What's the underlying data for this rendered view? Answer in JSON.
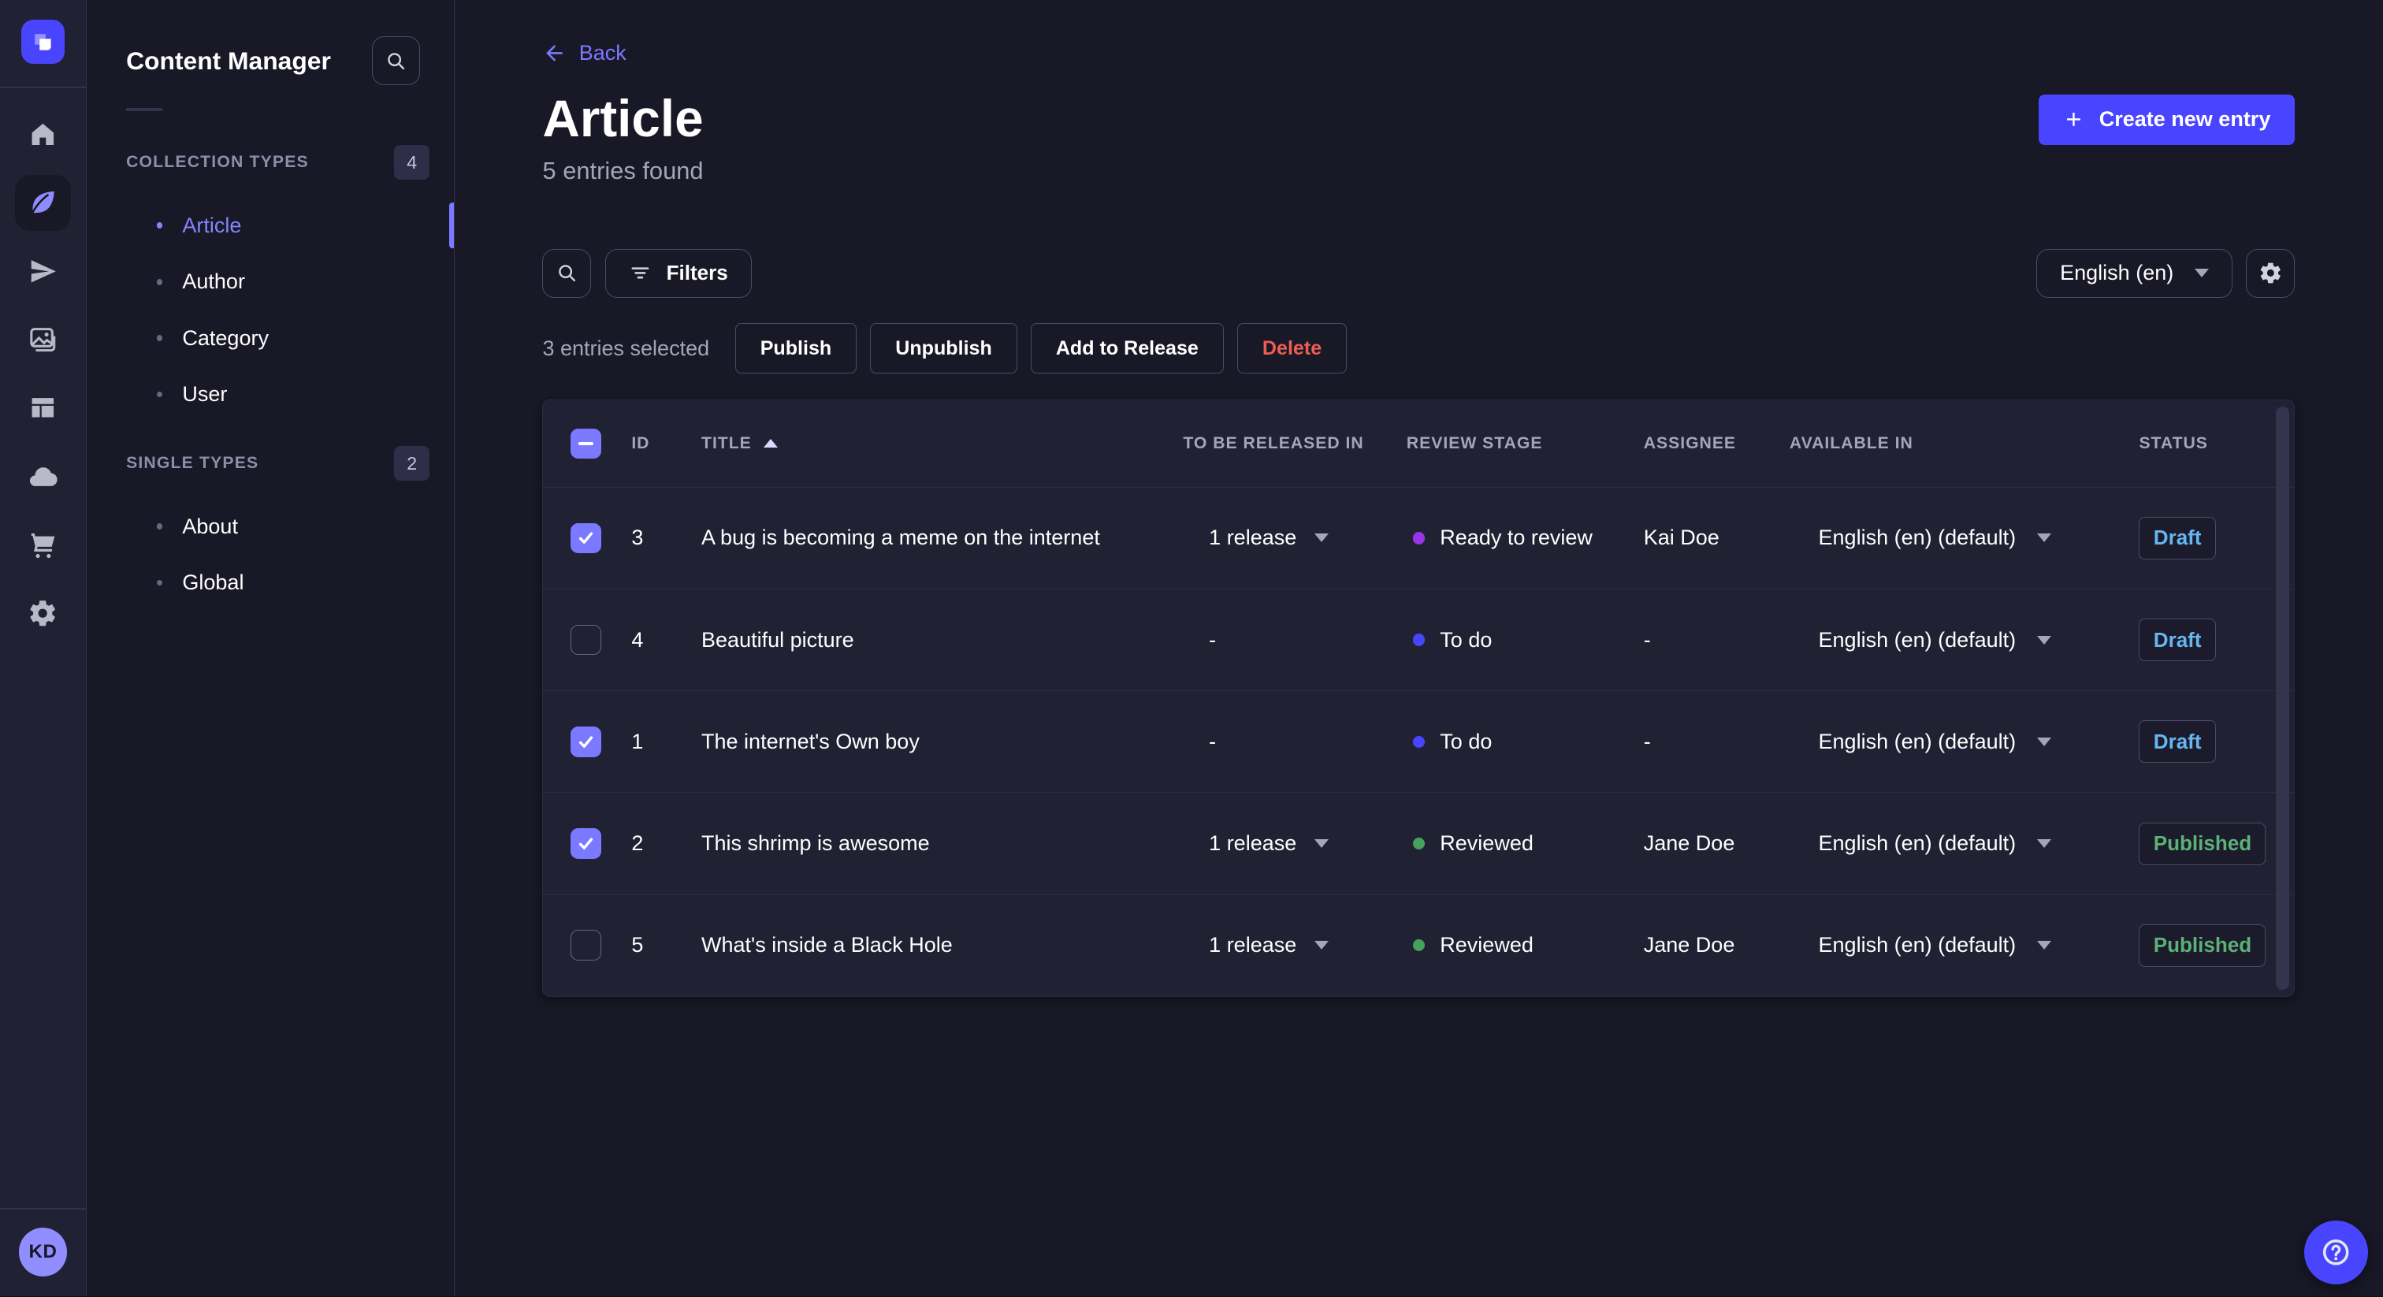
{
  "nav": {
    "items": [
      {
        "icon": "home-icon",
        "active": false
      },
      {
        "icon": "content-manager-feather-icon",
        "active": true
      },
      {
        "icon": "releases-paper-plane-icon",
        "active": false
      },
      {
        "icon": "media-library-pictures-icon",
        "active": false
      },
      {
        "icon": "content-type-builder-layout-icon",
        "active": false
      },
      {
        "icon": "cloud-icon",
        "active": false
      },
      {
        "icon": "marketplace-cart-icon",
        "active": false
      },
      {
        "icon": "settings-gear-icon",
        "active": false
      }
    ]
  },
  "user": {
    "initials": "KD"
  },
  "subnav": {
    "title": "Content Manager",
    "sections": [
      {
        "label": "COLLECTION TYPES",
        "badge": "4",
        "items": [
          {
            "label": "Article",
            "active": true
          },
          {
            "label": "Author",
            "active": false
          },
          {
            "label": "Category",
            "active": false
          },
          {
            "label": "User",
            "active": false
          }
        ]
      },
      {
        "label": "SINGLE TYPES",
        "badge": "2",
        "items": [
          {
            "label": "About",
            "active": false
          },
          {
            "label": "Global",
            "active": false
          }
        ]
      }
    ]
  },
  "header": {
    "back_label": "Back",
    "title": "Article",
    "subtitle": "5 entries found",
    "create_button_label": "Create new entry"
  },
  "toolbar": {
    "filters_label": "Filters",
    "locale_selected": "English (en)"
  },
  "selection": {
    "summary": "3 entries selected",
    "actions": [
      {
        "label": "Publish",
        "danger": false
      },
      {
        "label": "Unpublish",
        "danger": false
      },
      {
        "label": "Add to Release",
        "danger": false
      },
      {
        "label": "Delete",
        "danger": true
      }
    ]
  },
  "table": {
    "columns": [
      "ID",
      "TITLE",
      "TO BE RELEASED IN",
      "REVIEW STAGE",
      "ASSIGNEE",
      "AVAILABLE IN",
      "STATUS"
    ],
    "sorted_column": "TITLE",
    "sort_direction": "ascending",
    "rows": [
      {
        "selected": true,
        "id": "3",
        "title": "A bug is becoming a meme on the internet",
        "release": "1 release",
        "release_caret": true,
        "stage": "Ready to review",
        "stage_color": "#9736e8",
        "assignee": "Kai Doe",
        "locale": "English (en) (default)",
        "status": "Draft",
        "status_color": "#66b7f1"
      },
      {
        "selected": false,
        "id": "4",
        "title": "Beautiful picture",
        "release": "-",
        "release_caret": false,
        "stage": "To do",
        "stage_color": "#4945ff",
        "assignee": "-",
        "locale": "English (en) (default)",
        "status": "Draft",
        "status_color": "#66b7f1"
      },
      {
        "selected": true,
        "id": "1",
        "title": "The internet's Own boy",
        "release": "-",
        "release_caret": false,
        "stage": "To do",
        "stage_color": "#4945ff",
        "assignee": "-",
        "locale": "English (en) (default)",
        "status": "Draft",
        "status_color": "#66b7f1"
      },
      {
        "selected": true,
        "id": "2",
        "title": "This shrimp is awesome",
        "release": "1 release",
        "release_caret": true,
        "stage": "Reviewed",
        "stage_color": "#44a25e",
        "assignee": "Jane Doe",
        "locale": "English (en) (default)",
        "status": "Published",
        "status_color": "#5cb176"
      },
      {
        "selected": false,
        "id": "5",
        "title": "What's inside a Black Hole",
        "release": "1 release",
        "release_caret": true,
        "stage": "Reviewed",
        "stage_color": "#44a25e",
        "assignee": "Jane Doe",
        "locale": "English (en) (default)",
        "status": "Published",
        "status_color": "#5cb176"
      }
    ]
  },
  "colors": {
    "primary": "#4945ff",
    "primary_light": "#7b79ff",
    "danger": "#ee5e52",
    "draft": "#66b7f1",
    "published": "#5cb176"
  }
}
